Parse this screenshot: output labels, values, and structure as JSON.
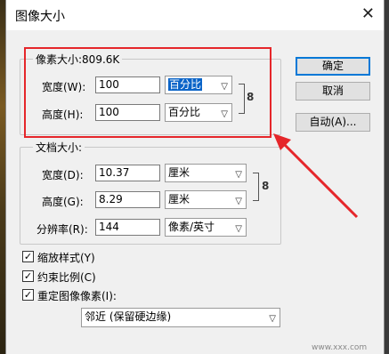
{
  "window": {
    "title": "图像大小"
  },
  "pixel_size": {
    "legend": "像素大小:809.6K",
    "width": {
      "label": "宽度(W):",
      "value": "100",
      "unit": "百分比"
    },
    "height": {
      "label": "高度(H):",
      "value": "100",
      "unit": "百分比"
    }
  },
  "document_size": {
    "legend": "文档大小:",
    "width": {
      "label": "宽度(D):",
      "value": "10.37",
      "unit": "厘米"
    },
    "height": {
      "label": "高度(G):",
      "value": "8.29",
      "unit": "厘米"
    },
    "resolution": {
      "label": "分辨率(R):",
      "value": "144",
      "unit": "像素/英寸"
    }
  },
  "buttons": {
    "ok": "确定",
    "cancel": "取消",
    "auto": "自动(A)..."
  },
  "checkboxes": {
    "scale_styles": {
      "label": "缩放样式(Y)",
      "checked": true
    },
    "constrain": {
      "label": "约束比例(C)",
      "checked": true
    },
    "resample": {
      "label": "重定图像像素(I):",
      "checked": true
    }
  },
  "resample_method": "邻近 (保留硬边缘)",
  "colors": {
    "annotation": "#e5262a",
    "selection": "#0a64c8"
  }
}
